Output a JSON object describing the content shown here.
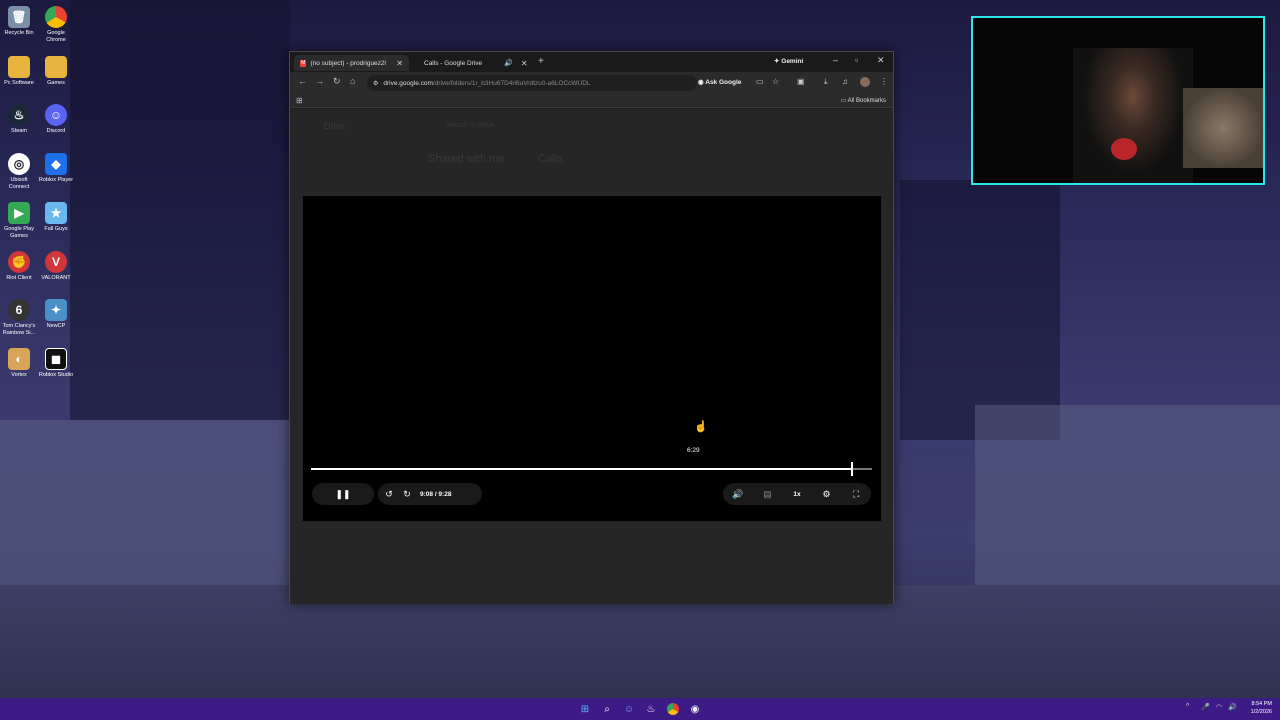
{
  "desktop": {
    "icons": [
      {
        "label": "Recycle Bin",
        "icon": "recycle-bin-icon"
      },
      {
        "label": "Google Chrome",
        "icon": "chrome-icon"
      },
      {
        "label": "Pc Software",
        "icon": "folder-icon"
      },
      {
        "label": "Games",
        "icon": "folder-icon"
      },
      {
        "label": "Steam",
        "icon": "steam-icon"
      },
      {
        "label": "Discord",
        "icon": "discord-icon"
      },
      {
        "label": "Ubisoft Connect",
        "icon": "ubisoft-icon"
      },
      {
        "label": "Roblox Player",
        "icon": "roblox-icon"
      },
      {
        "label": "Google Play Games",
        "icon": "google-play-games-icon"
      },
      {
        "label": "Fall Guys",
        "icon": "fall-guys-icon"
      },
      {
        "label": "Riot Client",
        "icon": "riot-client-icon"
      },
      {
        "label": "VALORANT",
        "icon": "valorant-icon"
      },
      {
        "label": "Tom Clancy's Rainbow Si...",
        "icon": "rainbow-six-icon"
      },
      {
        "label": "NewCP",
        "icon": "newcp-icon"
      },
      {
        "label": "Vortex",
        "icon": "vortex-icon"
      },
      {
        "label": "Roblox Studio",
        "icon": "roblox-studio-icon"
      }
    ]
  },
  "browser": {
    "tabs": [
      {
        "title": "(no subject) - prodriguez20001",
        "active": true
      },
      {
        "title": "Calls - Google Drive",
        "active": false
      }
    ],
    "new_tab_label": "+",
    "gemini_label": "Gemini",
    "url_host": "drive.google.com",
    "url_path": "/drive/folders/1r_b3Hu67D4rl6uVrdtzu0-a6LOCcWUDL",
    "ask_google_label": "Ask Google",
    "bookmarks_label": "All Bookmarks"
  },
  "drive_ghost": {
    "app_name": "Drive",
    "search_placeholder": "Search in Drive",
    "breadcrumb_root": "Shared with me",
    "breadcrumb_folder": "Calls"
  },
  "player": {
    "hover_time": "6:29",
    "current_time": "9:08",
    "duration": "9:28",
    "time_display": "9:08 / 9:28",
    "speed": "1x",
    "progress_fraction": 0.9648
  },
  "taskbar": {
    "apps": [
      "start-icon",
      "search-icon",
      "discord-icon",
      "steam-icon",
      "chrome-icon",
      "obs-icon"
    ],
    "time": "8:54 PM",
    "date": "1/2/2026"
  },
  "colors": {
    "webcam_border": "#2ee6e6",
    "taskbar": "#3d1b86"
  }
}
